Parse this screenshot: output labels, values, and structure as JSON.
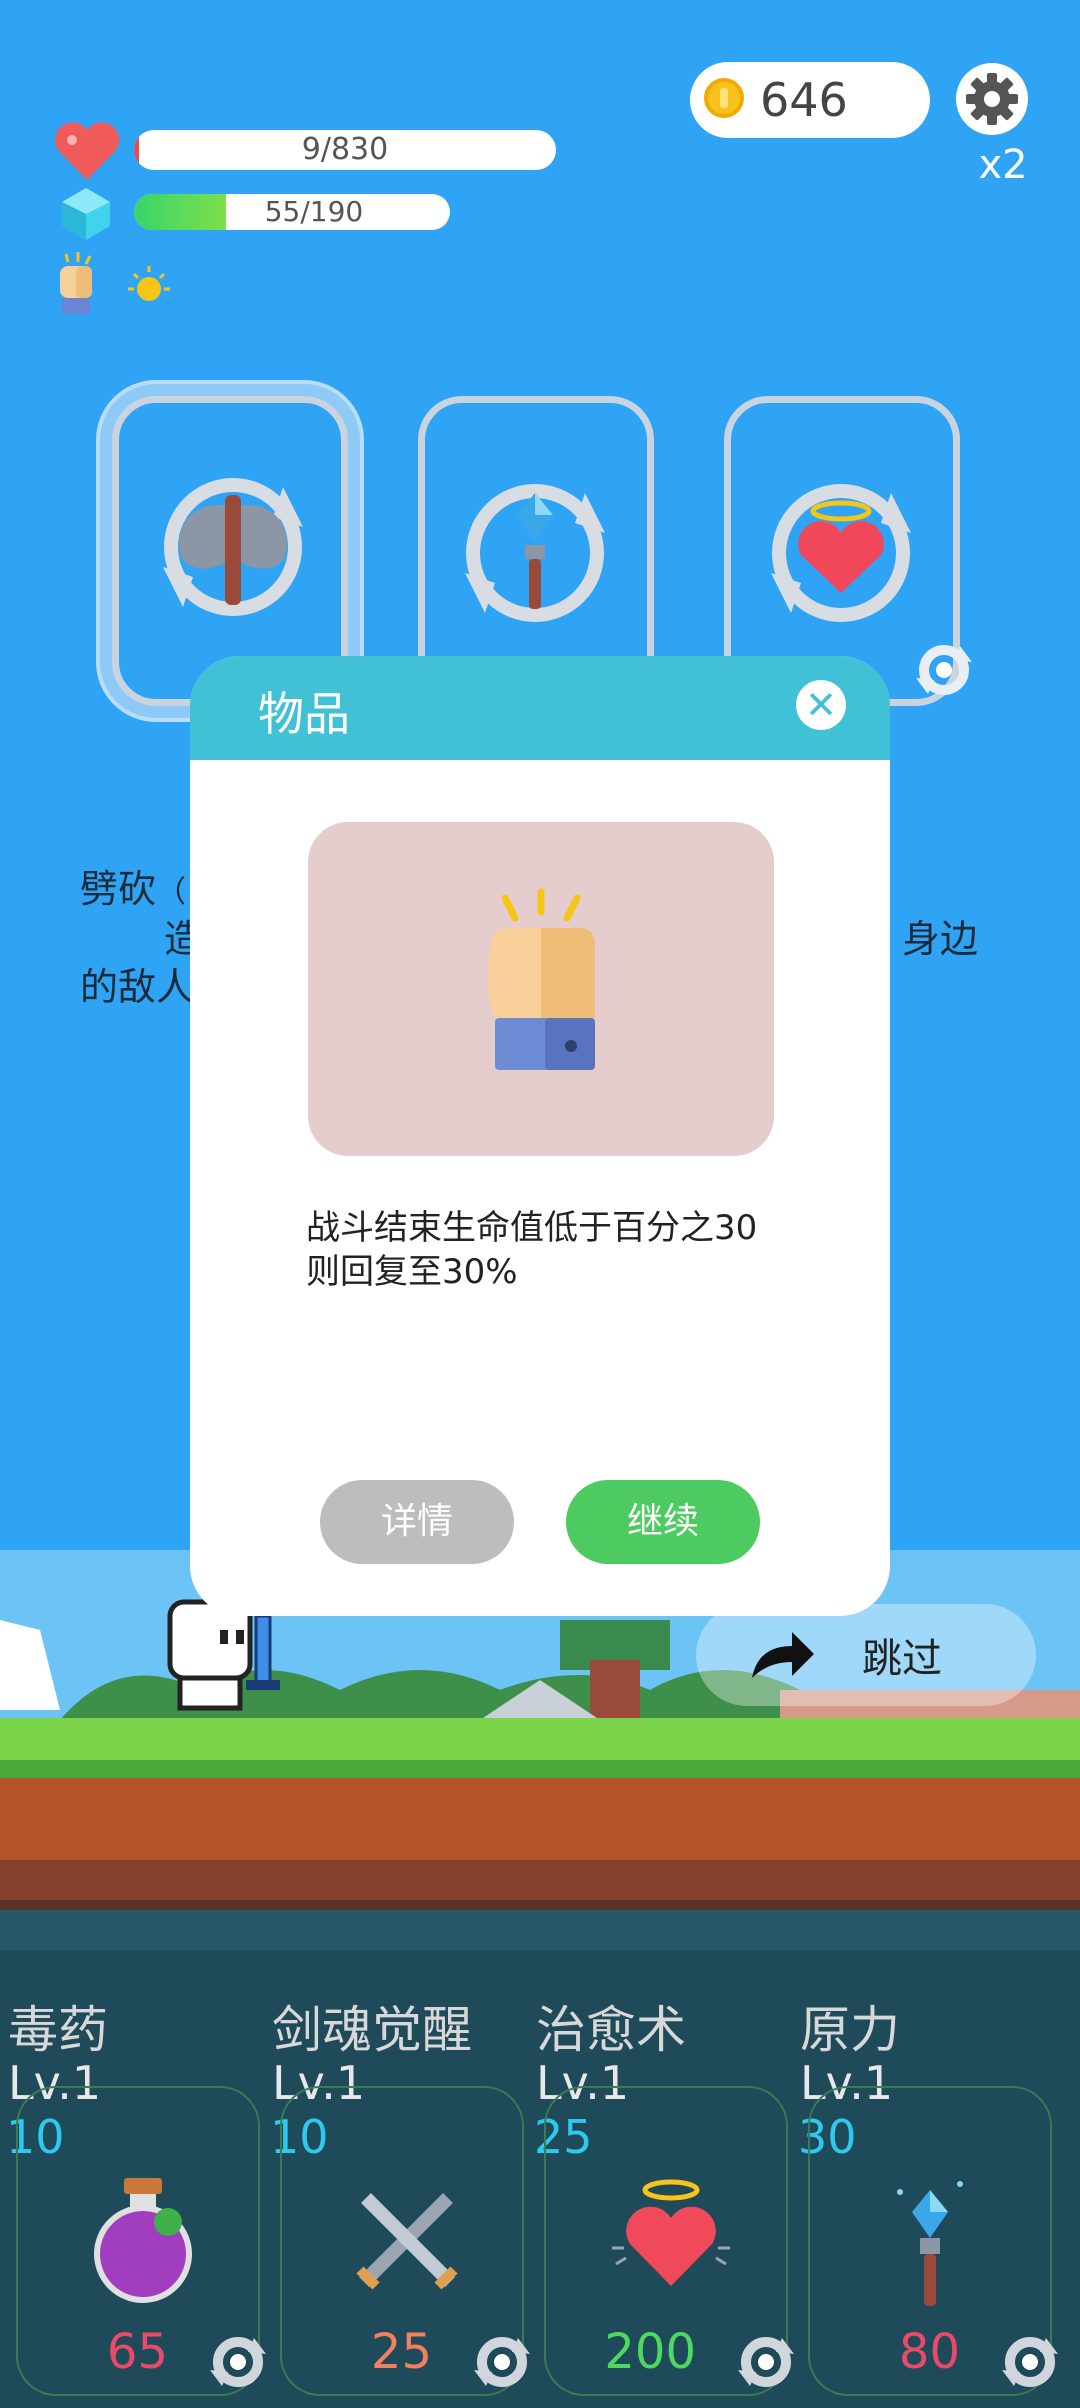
{
  "status": {
    "coins": "646",
    "speed": "x2",
    "hp": {
      "text": "9/830",
      "fraction": 0.011
    },
    "mp": {
      "text": "55/190",
      "fraction": 0.29
    }
  },
  "reward_cards": [
    {
      "icon": "battle-axe-icon"
    },
    {
      "icon": "crystal-staff-icon"
    },
    {
      "icon": "angel-heart-icon"
    }
  ],
  "background_text": {
    "line1": "劈砍",
    "line1_extra": "（",
    "line2": "造",
    "line2_right": "身边",
    "line3": "的敌人"
  },
  "dialog": {
    "title": "物品",
    "close": "✕",
    "item_icon": "raised-fist-icon",
    "description": "战斗结束生命值低于百分之30则回复至30%",
    "detail_button": "详情",
    "continue_button": "继续"
  },
  "skip": {
    "label": "跳过"
  },
  "skills": [
    {
      "name": "毒药",
      "level": "Lv.1",
      "cost": "10",
      "count": "65",
      "count_color": "#e94a6a",
      "icon": "poison-potion-icon"
    },
    {
      "name": "剑魂觉醒",
      "level": "Lv.1",
      "cost": "10",
      "count": "25",
      "count_color": "#f08060",
      "icon": "crossed-swords-icon"
    },
    {
      "name": "治愈术",
      "level": "Lv.1",
      "cost": "25",
      "count": "200",
      "count_color": "#4ed860",
      "icon": "heal-heart-icon"
    },
    {
      "name": "原力",
      "level": "Lv.1",
      "cost": "30",
      "count": "80",
      "count_color": "#e94a6a",
      "icon": "crystal-wand-icon"
    }
  ]
}
